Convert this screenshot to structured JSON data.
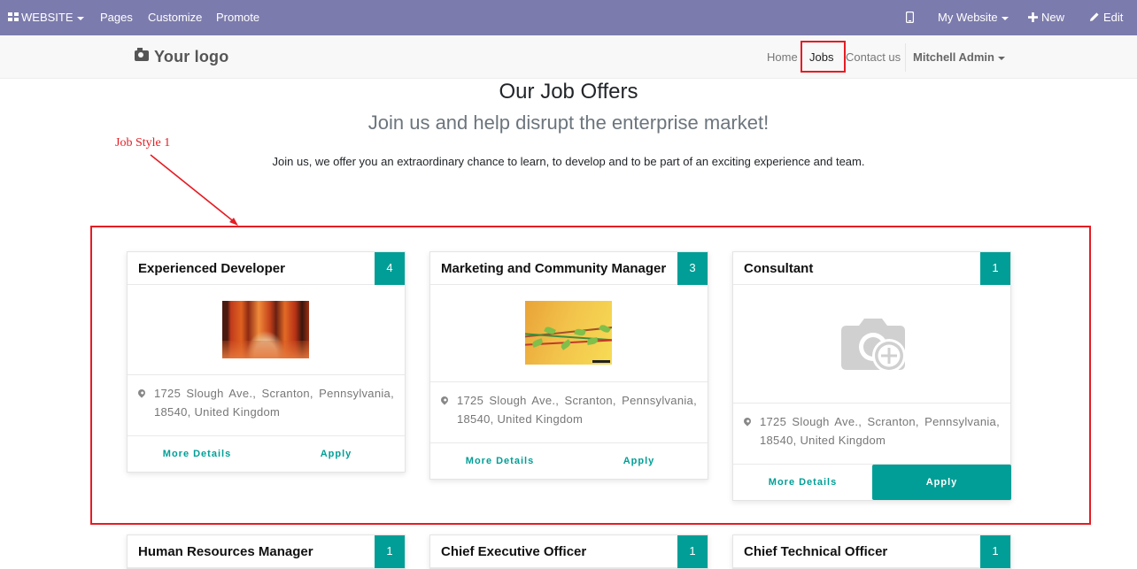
{
  "topbar": {
    "website_label": "WEBSITE",
    "menu": [
      "Pages",
      "Customize",
      "Promote"
    ],
    "mobile_icon": "mobile-icon",
    "my_website_label": "My Website",
    "new_label": "New",
    "edit_label": "Edit",
    "bg_color": "#7c7bad"
  },
  "header": {
    "logo_text": "Your logo",
    "nav": [
      {
        "label": "Home"
      },
      {
        "label": "Jobs",
        "active": true
      },
      {
        "label": "Contact us"
      }
    ],
    "user_label": "Mitchell Admin"
  },
  "page": {
    "title": "Our Job Offers",
    "subtitle": "Join us and help disrupt the enterprise market!",
    "lead": "Join us, we offer you an extraordinary chance to learn, to develop and to be part of an exciting experience and team."
  },
  "annotation": {
    "label": "Job Style 1",
    "color": "#e51c23"
  },
  "jobs": [
    {
      "title": "Experienced Developer",
      "count": "4",
      "image": "autumn-forest-image",
      "address": "1725 Slough Ave., Scranton, Pennsylvania, 18540, United Kingdom",
      "more_label": "More Details",
      "apply_label": "Apply"
    },
    {
      "title": "Marketing and Community Manager",
      "count": "3",
      "image": "green-vine-image",
      "address": "1725 Slough Ave., Scranton, Pennsylvania, 18540, United Kingdom",
      "more_label": "More Details",
      "apply_label": "Apply"
    },
    {
      "title": "Consultant",
      "count": "1",
      "image": "camera-placeholder-icon",
      "address": "1725 Slough Ave., Scranton, Pennsylvania, 18540, United Kingdom",
      "more_label": "More Details",
      "apply_label": "Apply"
    },
    {
      "title": "Human Resources Manager",
      "count": "1"
    },
    {
      "title": "Chief Executive Officer",
      "count": "1"
    },
    {
      "title": "Chief Technical Officer",
      "count": "1"
    }
  ],
  "accent_color": "#009e96"
}
